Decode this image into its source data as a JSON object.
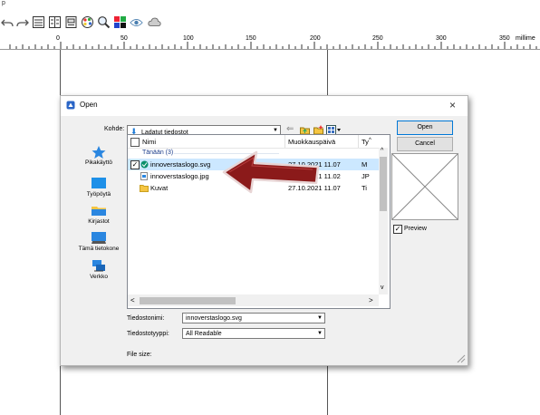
{
  "app": {
    "menu_letter": "p"
  },
  "toolbar": {
    "icons": [
      "undo-icon",
      "redo-icon",
      "page-layout-icon",
      "two-page-icon",
      "print-preview-icon",
      "color-palette-icon",
      "zoom-icon",
      "color-grid-icon",
      "eye-icon",
      "cloud-icon"
    ]
  },
  "ruler": {
    "labels": [
      "0",
      "50",
      "100",
      "150",
      "200",
      "250",
      "300",
      "350"
    ],
    "unit": "millime"
  },
  "dialog": {
    "title": "Open",
    "close_glyph": "×",
    "lookin_label": "Kohde:",
    "lookin_value": "Ladatut tiedostot",
    "places": [
      {
        "label": "Pikakäyttö",
        "icon": "star-icon"
      },
      {
        "label": "Työpöytä",
        "icon": "desktop-icon"
      },
      {
        "label": "Kirjastot",
        "icon": "library-icon"
      },
      {
        "label": "Tämä tietokone",
        "icon": "computer-icon"
      },
      {
        "label": "Verkko",
        "icon": "network-icon"
      }
    ],
    "columns": {
      "name": "Nimi",
      "modified": "Muokkauspäivä",
      "type": "Ty"
    },
    "group": "Tänään (3)",
    "files": [
      {
        "name": "innoverstaslogo.svg",
        "date": "27.10.2021 11.07",
        "type": "M",
        "selected": true
      },
      {
        "name": "innoverstaslogo.jpg",
        "date": "27.10.2021 11.02",
        "type": "JP",
        "selected": false
      },
      {
        "name": "Kuvat",
        "date": "27.10.2021 11.07",
        "type": "Ti",
        "selected": false
      }
    ],
    "filename_label": "Tiedostonimi:",
    "filename_value": "innoverstaslogo.svg",
    "filetype_label": "Tiedostotyyppi:",
    "filetype_value": "All Readable",
    "filesize_label": "File size:",
    "open_button": "Open",
    "cancel_button": "Cancel",
    "preview_label": "Preview",
    "preview_checked": true
  },
  "colors": {
    "selection": "#cce8ff",
    "arrow": "#8b1a1a",
    "folder": "#f5c542",
    "accent": "#1c7ad6"
  }
}
